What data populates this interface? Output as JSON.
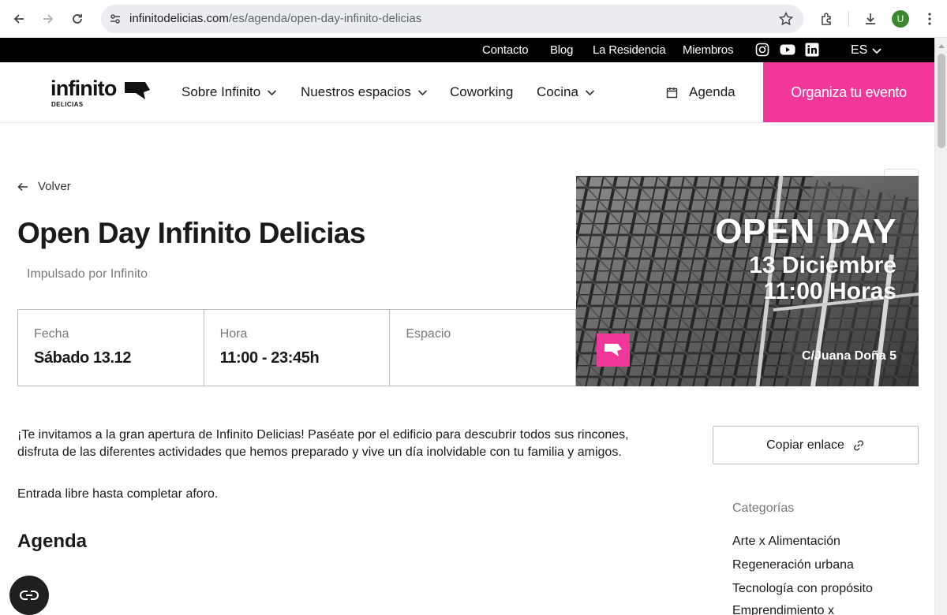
{
  "browser": {
    "url_host": "infinitodelicias.com",
    "url_path": "/es/agenda/open-day-infinito-delicias",
    "profile_initial": "U"
  },
  "topbar": {
    "links": [
      "Contacto",
      "Blog",
      "La Residencia",
      "Miembros"
    ],
    "social_icons": [
      "instagram-icon",
      "youtube-icon",
      "linkedin-icon"
    ],
    "language": "ES"
  },
  "header": {
    "logo_word": "infinito",
    "logo_sub": "DELICIAS",
    "menu": [
      {
        "label": "Sobre Infinito",
        "dropdown": true
      },
      {
        "label": "Nuestros espacios",
        "dropdown": true
      },
      {
        "label": "Coworking",
        "dropdown": false
      },
      {
        "label": "Cocina",
        "dropdown": true
      }
    ],
    "agenda_label": "Agenda",
    "cta_label": "Organiza tu evento",
    "accent_color": "#f2379a"
  },
  "event": {
    "back_label": "Volver",
    "title": "Open Day Infinito Delicias",
    "subtitle": "Impulsado por Infinito",
    "info": [
      {
        "label": "Fecha",
        "value": "Sábado 13.12"
      },
      {
        "label": "Hora",
        "value": "11:00 - 23:45h"
      },
      {
        "label": "Espacio",
        "value": ""
      }
    ],
    "hero": {
      "line1": "OPEN DAY",
      "line2": "13 Diciembre",
      "line3": "11:00 Horas",
      "address": "C/Juana Doña 5"
    },
    "description": "¡Te invitamos a la gran apertura de Infinito Delicias! Paséate por el edificio para descubrir todos sus rincones, disfruta de las diferentes actividades que hemos preparado y vive un día inolvidable con tu familia y amigos.",
    "entry_note": "Entrada libre hasta completar aforo.",
    "agenda_heading": "Agenda"
  },
  "sidebar": {
    "copy_label": "Copiar enlace",
    "categories_title": "Categorías",
    "categories": [
      "Arte x Alimentación",
      "Regeneración urbana",
      "Tecnología con propósito",
      "Emprendimiento x"
    ]
  }
}
